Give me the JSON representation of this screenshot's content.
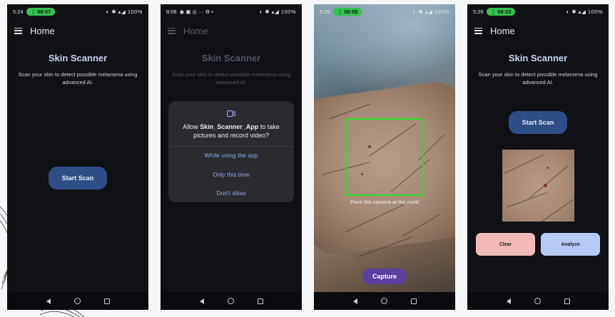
{
  "screens": [
    {
      "status": {
        "time": "5:24",
        "call": "08:07",
        "battery": "100%"
      },
      "appbar_title": "Home",
      "title": "Skin Scanner",
      "description": "Scan your skin to detect possible melanoma using advanced AI.",
      "start_scan": "Start Scan"
    },
    {
      "status": {
        "time": "8:08",
        "battery": "100%"
      },
      "appbar_title": "Home",
      "title": "Skin Scanner",
      "description": "Scan your skin to detect possible melanoma using advanced AI.",
      "dialog": {
        "prefix": "Allow ",
        "app_name": "Skin_Scanner_App",
        "suffix": " to take pictures and record video?",
        "options": [
          "While using the app",
          "Only this time",
          "Don't allow"
        ]
      }
    },
    {
      "status": {
        "time": "5:25",
        "call": "09:05",
        "battery": "100%"
      },
      "hint": "Point the camera at the mold",
      "capture": "Capture"
    },
    {
      "status": {
        "time": "5:26",
        "call": "09:15",
        "battery": "100%"
      },
      "appbar_title": "Home",
      "title": "Skin Scanner",
      "description": "Scan your skin to detect possible melanoma using advanced AI.",
      "start_scan": "Start Scan",
      "clear": "Clear",
      "analyze": "Analyze"
    }
  ],
  "colors": {
    "accent": "#2f4d86",
    "capture": "#5a3f9e",
    "clear": "#f1b9b8",
    "analyze": "#b9c9f6",
    "frame": "#2cdd2c"
  }
}
